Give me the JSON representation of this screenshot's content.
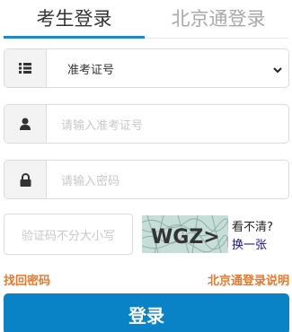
{
  "tabs": {
    "active": "考生登录",
    "inactive": "北京通登录"
  },
  "id_type": {
    "selected": "准考证号"
  },
  "username": {
    "placeholder": "请输入准考证号"
  },
  "password": {
    "placeholder": "请输入密码"
  },
  "captcha": {
    "placeholder": "验证码不分大小写",
    "image_text": "WGZ>",
    "unclear_label": "看不清?",
    "refresh_label": "换一张"
  },
  "links": {
    "forgot_password": "找回密码",
    "beijingtong_help": "北京通登录说明"
  },
  "login_button": "登录",
  "colors": {
    "accent": "#0a83c6",
    "link_orange": "#e8782c"
  }
}
